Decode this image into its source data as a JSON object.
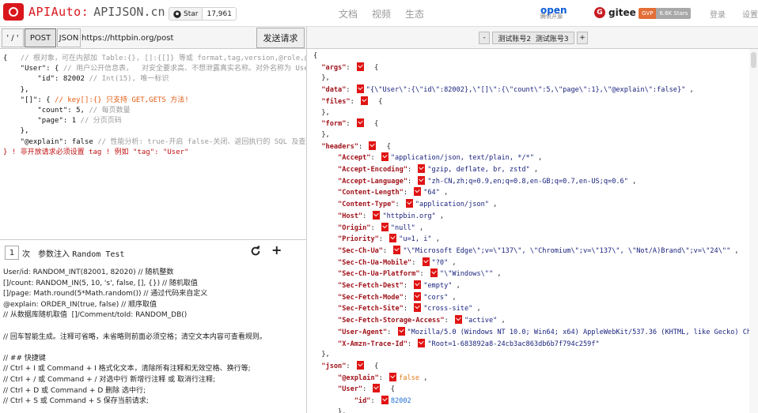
{
  "header": {
    "app_name": "APIAuto:",
    "site": "APIJSON.cn",
    "star_label": "Star",
    "star_count": "17,961",
    "nav": [
      "文档",
      "视频",
      "生态"
    ],
    "open_badge": "open",
    "open_sub": "腾讯开源",
    "gitee": "gitee",
    "gvp_left": "GVP",
    "gvp_right": "6.6K Stars",
    "login": "登录",
    "settings": "设置"
  },
  "toolbar": {
    "tag_label": "' / '",
    "method_post": "POST",
    "type_json": "JSON",
    "url": "https://httpbin.org/post",
    "send": "发送请求"
  },
  "request_lines": [
    "{   // 根对象，可在内部加 Table:{}, []:{[]} 等或 format,tag,version,@role,@database,@schema,@datasource,@explain,@cache 等全局关键词键值对",
    "    \"User\": { // 用户公开信息表，  对安全要求高、不想泄露真实名称。对外名称为 User",
    "        \"id\": 82002 // Int(15), 唯一标识",
    "    },",
    "    \"[]\": { // key[]:{} 只支持 GET,GETS 方法!",
    "        \"count\": 5, // 每页数量",
    "        \"page\": 1 // 分页页码",
    "    },",
    "    \"@explain\": false // 性能分析: true-开启 false-关闭、返回执行的 SQL 及查询计划",
    "} ! 非开放请求必须设置 tag ! 例如 \"tag\": \"User\""
  ],
  "random": {
    "count": "1",
    "count_unit": "次",
    "title_cn": "参数注入",
    "title_en": "Random Test",
    "lines": [
      "User/id: RANDOM_INT(82001, 82020) // 随机整数",
      "[]/count: RANDOM_IN(5, 10, 's', false, [], {}) // 随机取值",
      "[]/page: Math.round(5*Math.random()) // 通过代码来自定义",
      "@explain: ORDER_IN(true, false) // 顺序取值",
      "// 从数据库随机取值  []/Comment/toId: RANDOM_DB()",
      "",
      "// 回车智能生成。注释可省略，未省略则前面必须空格；清空文本内容可查看规则。",
      "",
      "// ## 快捷键",
      "// Ctrl + I 或 Command + I 格式化文本，清除所有注释和无效空格、换行等;",
      "// Ctrl + / 或 Command + / 对选中行 新增行注释 或 取消行注释;",
      "// Ctrl + D 或 Command + D 删除 选中行;",
      "// Ctrl + S 或 Command + S 保存当前请求;"
    ]
  },
  "accounts": {
    "minus": "-",
    "acct2": "测试账号2",
    "acct3": "测试账号3",
    "plus": "+"
  },
  "response": {
    "data_value": "\"{\\\"User\\\":{\\\"id\\\":82002},\\\"[]\\\":{\\\"count\\\":5,\\\"page\\\":1},\\\"@explain\\\":false}\"",
    "headers": [
      {
        "k": "Accept",
        "v": "\"application/json, text/plain, */*\""
      },
      {
        "k": "Accept-Encoding",
        "v": "\"gzip, deflate, br, zstd\""
      },
      {
        "k": "Accept-Language",
        "v": "\"zh-CN,zh;q=0.9,en;q=0.8,en-GB;q=0.7,en-US;q=0.6\""
      },
      {
        "k": "Content-Length",
        "v": "\"64\""
      },
      {
        "k": "Content-Type",
        "v": "\"application/json\""
      },
      {
        "k": "Host",
        "v": "\"httpbin.org\""
      },
      {
        "k": "Origin",
        "v": "\"null\""
      },
      {
        "k": "Priority",
        "v": "\"u=1, i\""
      },
      {
        "k": "Sec-Ch-Ua",
        "v": "\"\\\"Microsoft Edge\\\";v=\\\"137\\\", \\\"Chromium\\\";v=\\\"137\\\", \\\"Not/A)Brand\\\";v=\\\"24\\\"\""
      },
      {
        "k": "Sec-Ch-Ua-Mobile",
        "v": "\"?0\""
      },
      {
        "k": "Sec-Ch-Ua-Platform",
        "v": "\"\\\"Windows\\\"\""
      },
      {
        "k": "Sec-Fetch-Dest",
        "v": "\"empty\""
      },
      {
        "k": "Sec-Fetch-Mode",
        "v": "\"cors\""
      },
      {
        "k": "Sec-Fetch-Site",
        "v": "\"cross-site\""
      },
      {
        "k": "Sec-Fetch-Storage-Access",
        "v": "\"active\""
      }
    ],
    "user_agent": "\"Mozilla/5.0 (Windows NT 10.0; Win64; x64) AppleWebKit/537.36 (KHTML, like Gecko) Chrome/137.0.0.0 Safari/537.36 Edg/137.0.0.0\"",
    "trace_id": "\"Root=1-683892a8-24cb3ac863db6b7f794c259f\"",
    "json_explain": "false",
    "json_user_id": "82002"
  },
  "colors": {
    "brand": "#d9161c",
    "json_key": "#a0131b",
    "check": "#e01414"
  }
}
